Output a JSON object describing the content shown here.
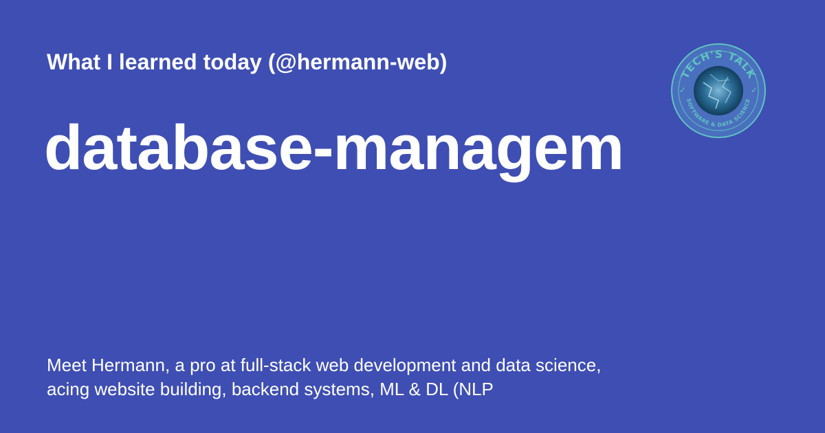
{
  "header": {
    "subtitle": "What I learned today (@hermann-web)"
  },
  "main": {
    "tag_title": "database-managem"
  },
  "footer": {
    "description": "Meet Hermann, a pro at full-stack web development and data science, acing website building, backend systems, ML & DL (NLP"
  },
  "logo": {
    "icon": "techs-talk-logo",
    "text_top": "TECH'S TALK",
    "text_bottom": "SOFTWARE & DATA SCIENCE"
  },
  "colors": {
    "background": "#3e4eb3",
    "text": "#ffffff",
    "logo_ring": "#5fc4c0",
    "logo_inner": "#1f5f8a"
  }
}
